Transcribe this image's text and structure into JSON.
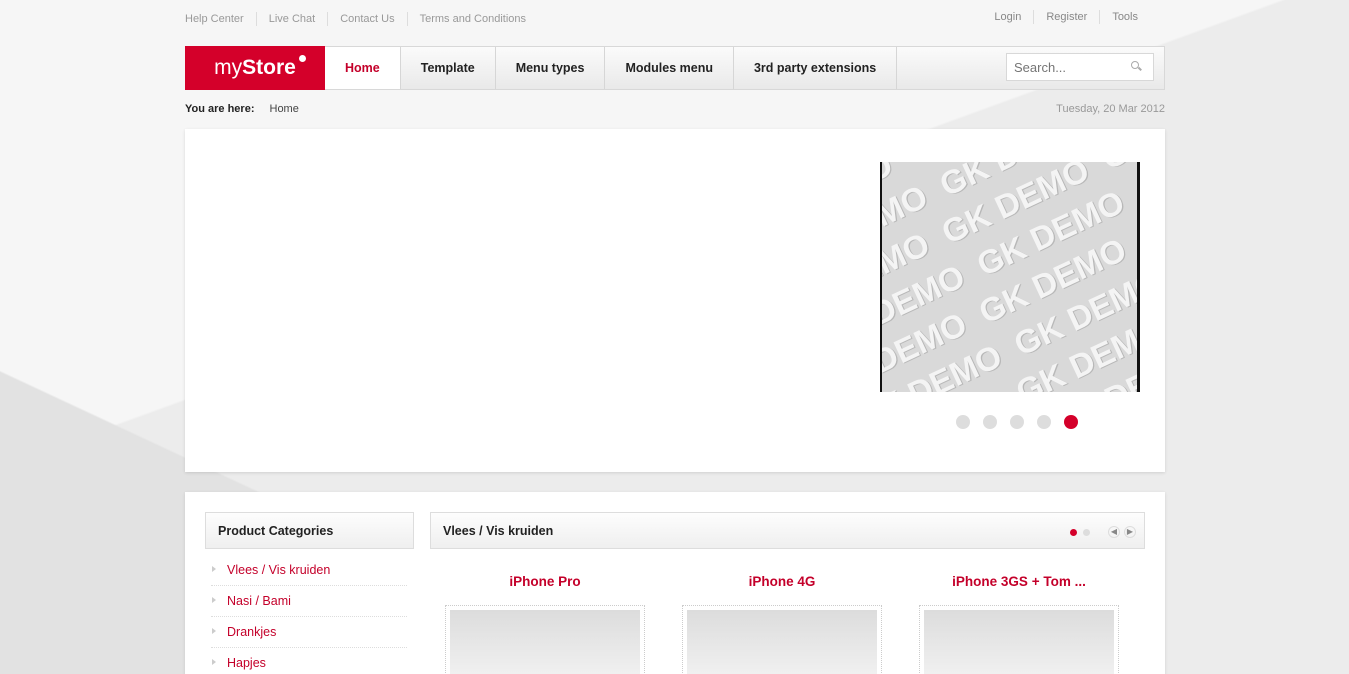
{
  "top_links": [
    "Help Center",
    "Live Chat",
    "Contact Us",
    "Terms and Conditions"
  ],
  "user_links": [
    "Login",
    "Register",
    "Tools"
  ],
  "logo": {
    "light": "my",
    "bold": "Store"
  },
  "nav": [
    "Home",
    "Template",
    "Menu types",
    "Modules menu",
    "3rd party extensions"
  ],
  "search": {
    "placeholder": "Search..."
  },
  "breadcrumb": {
    "label": "You are here:",
    "current": "Home"
  },
  "date": "Tuesday, 20 Mar 2012",
  "slider": {
    "image_text": "GK DEMO",
    "dot_count": 5,
    "active_dot": 5
  },
  "categories": {
    "title": "Product Categories",
    "items": [
      "Vlees / Vis kruiden",
      "Nasi / Bami",
      "Drankjes",
      "Hapjes"
    ]
  },
  "products": {
    "title": "Vlees / Vis kruiden",
    "page_dots": 2,
    "active_page": 1,
    "items": [
      "iPhone Pro",
      "iPhone 4G",
      "iPhone 3GS + Tom ..."
    ]
  },
  "colors": {
    "accent": "#d4002a"
  }
}
